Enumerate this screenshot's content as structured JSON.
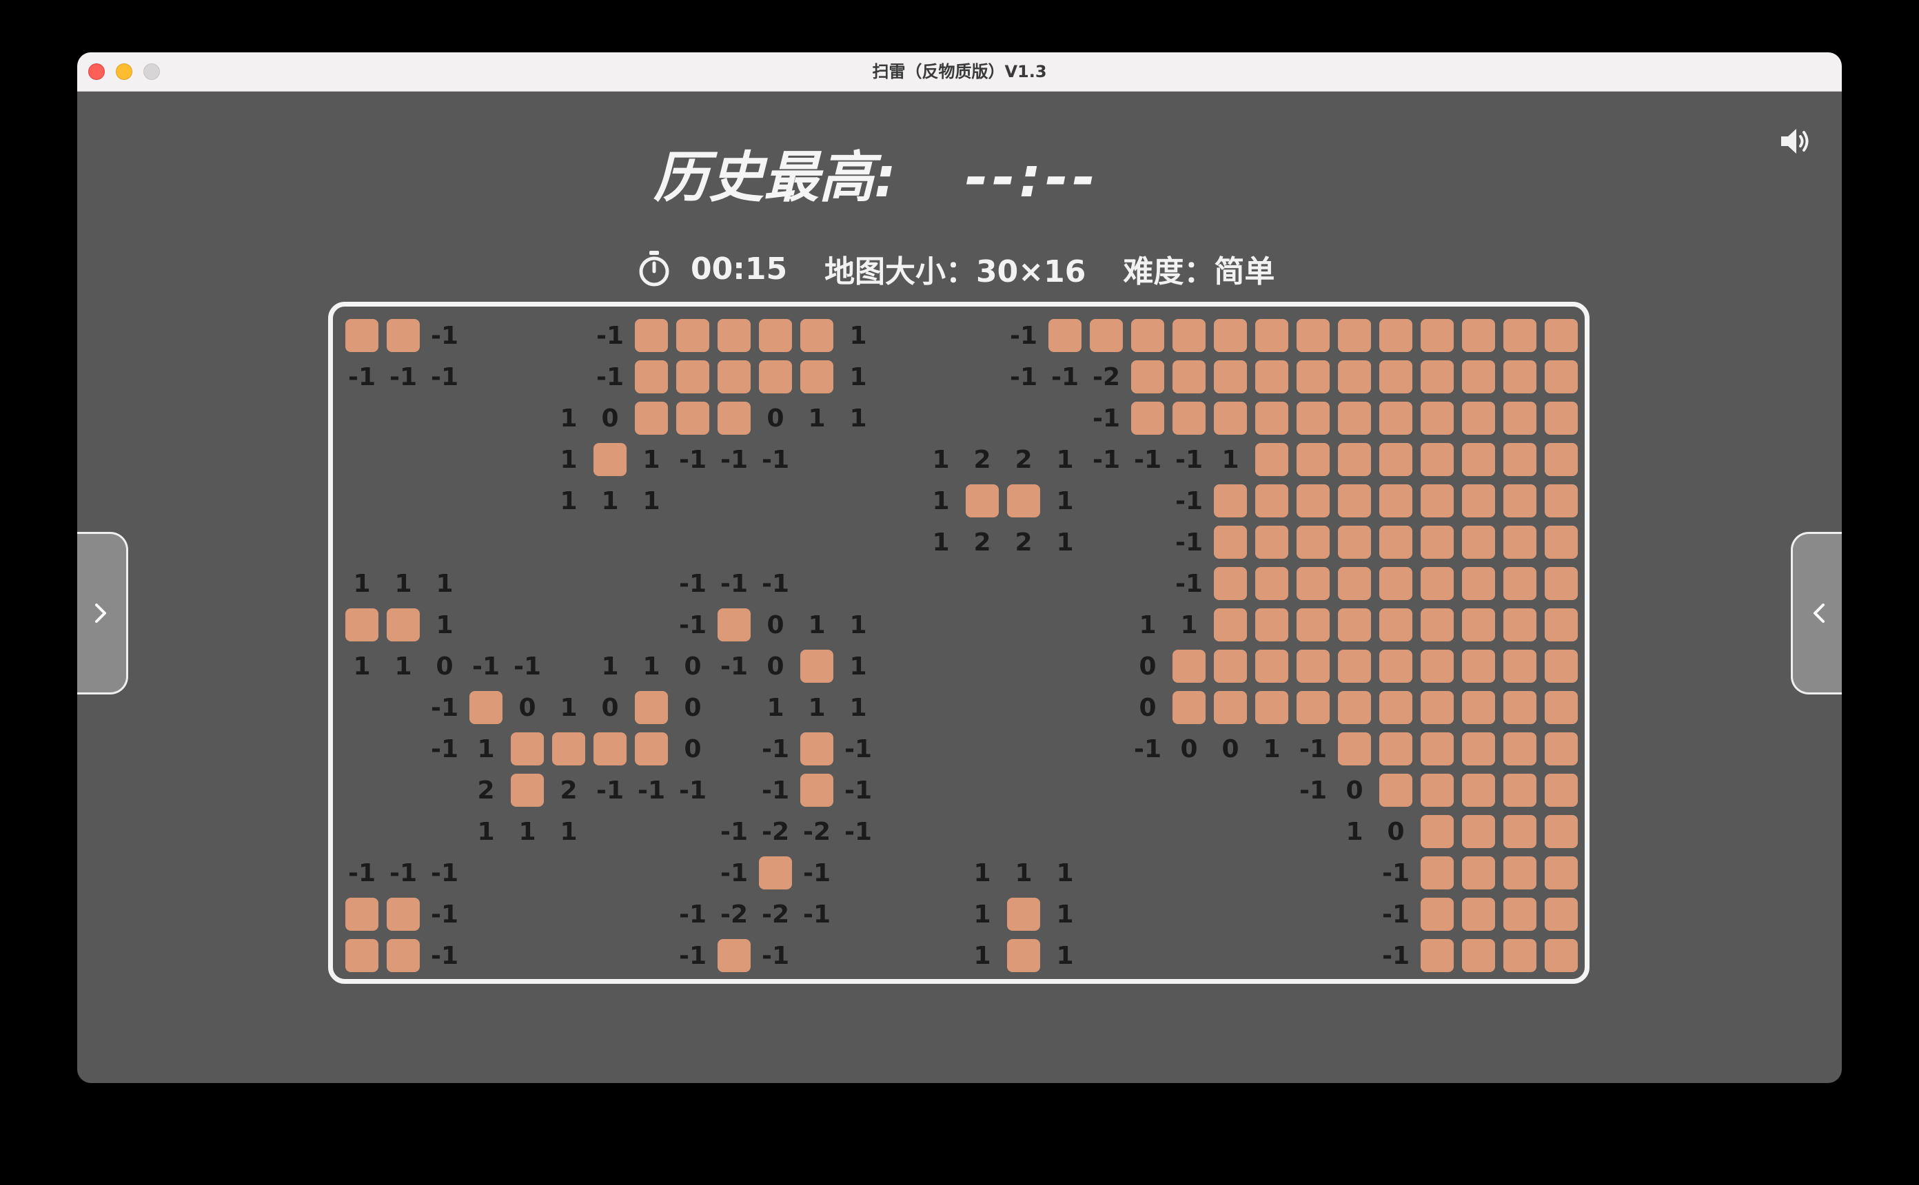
{
  "window": {
    "title": "扫雷（反物质版）V1.3"
  },
  "header": {
    "best_label": "历史最高:",
    "best_value": "--:--"
  },
  "info": {
    "timer": "00:15",
    "map_size": "地图大小：30×16",
    "difficulty": "难度：简单"
  },
  "icons": {
    "sound": "speaker-volume-icon",
    "timer": "stopwatch-icon",
    "left_nav": "chevron-right-icon",
    "right_nav": "chevron-left-icon"
  },
  "colors": {
    "background": "#585858",
    "covered_cell": "#dd9a78",
    "number_text": "#1b1b1b",
    "board_border": "#f4f4f4",
    "nav_button": "#8a8a8a"
  },
  "board": {
    "cols": 30,
    "rows": 16,
    "legend": "# = covered cell, . = empty revealed cell, other values = number shown",
    "grid": [
      [
        "#",
        "#",
        "-1",
        ".",
        ".",
        ".",
        "-1",
        "#",
        "#",
        "#",
        "#",
        "#",
        "1",
        ".",
        ".",
        ".",
        "-1",
        "#",
        "#",
        "#",
        "#",
        "#",
        "#",
        "#",
        "#",
        "#",
        "#",
        "#",
        "#",
        "#"
      ],
      [
        "-1",
        "-1",
        "-1",
        ".",
        ".",
        ".",
        "-1",
        "#",
        "#",
        "#",
        "#",
        "#",
        "1",
        ".",
        ".",
        ".",
        "-1",
        "-1",
        "-2",
        "#",
        "#",
        "#",
        "#",
        "#",
        "#",
        "#",
        "#",
        "#",
        "#",
        "#"
      ],
      [
        ".",
        ".",
        ".",
        ".",
        ".",
        "1",
        "0",
        "#",
        "#",
        "#",
        "0",
        "1",
        "1",
        ".",
        ".",
        ".",
        ".",
        ".",
        "-1",
        "#",
        "#",
        "#",
        "#",
        "#",
        "#",
        "#",
        "#",
        "#",
        "#",
        "#"
      ],
      [
        ".",
        ".",
        ".",
        ".",
        ".",
        "1",
        "#",
        "1",
        "-1",
        "-1",
        "-1",
        ".",
        ".",
        ".",
        "1",
        "2",
        "2",
        "1",
        "-1",
        "-1",
        "-1",
        "1",
        "#",
        "#",
        "#",
        "#",
        "#",
        "#",
        "#",
        "#"
      ],
      [
        ".",
        ".",
        ".",
        ".",
        ".",
        "1",
        "1",
        "1",
        ".",
        ".",
        ".",
        ".",
        ".",
        ".",
        "1",
        "#",
        "#",
        "1",
        ".",
        ".",
        "-1",
        "#",
        "#",
        "#",
        "#",
        "#",
        "#",
        "#",
        "#",
        "#"
      ],
      [
        ".",
        ".",
        ".",
        ".",
        ".",
        ".",
        ".",
        ".",
        ".",
        ".",
        ".",
        ".",
        ".",
        ".",
        "1",
        "2",
        "2",
        "1",
        ".",
        ".",
        "-1",
        "#",
        "#",
        "#",
        "#",
        "#",
        "#",
        "#",
        "#",
        "#"
      ],
      [
        "1",
        "1",
        "1",
        ".",
        ".",
        ".",
        ".",
        ".",
        "-1",
        "-1",
        "-1",
        ".",
        ".",
        ".",
        ".",
        ".",
        ".",
        ".",
        ".",
        ".",
        "-1",
        "#",
        "#",
        "#",
        "#",
        "#",
        "#",
        "#",
        "#",
        "#"
      ],
      [
        "#",
        "#",
        "1",
        ".",
        ".",
        ".",
        ".",
        ".",
        "-1",
        "#",
        "0",
        "1",
        "1",
        ".",
        ".",
        ".",
        ".",
        ".",
        ".",
        "1",
        "1",
        "#",
        "#",
        "#",
        "#",
        "#",
        "#",
        "#",
        "#",
        "#"
      ],
      [
        "1",
        "1",
        "0",
        "-1",
        "-1",
        ".",
        "1",
        "1",
        "0",
        "-1",
        "0",
        "#",
        "1",
        ".",
        ".",
        ".",
        ".",
        ".",
        ".",
        "0",
        "#",
        "#",
        "#",
        "#",
        "#",
        "#",
        "#",
        "#",
        "#",
        "#"
      ],
      [
        ".",
        ".",
        "-1",
        "#",
        "0",
        "1",
        "0",
        "#",
        "0",
        ".",
        "1",
        "1",
        "1",
        ".",
        ".",
        ".",
        ".",
        ".",
        ".",
        "0",
        "#",
        "#",
        "#",
        "#",
        "#",
        "#",
        "#",
        "#",
        "#",
        "#"
      ],
      [
        ".",
        ".",
        "-1",
        "1",
        "#",
        "#",
        "#",
        "#",
        "0",
        ".",
        "-1",
        "#",
        "-1",
        ".",
        ".",
        ".",
        ".",
        ".",
        ".",
        "-1",
        "0",
        "0",
        "1",
        "-1",
        "#",
        "#",
        "#",
        "#",
        "#",
        "#"
      ],
      [
        ".",
        ".",
        ".",
        "2",
        "#",
        "2",
        "-1",
        "-1",
        "-1",
        ".",
        "-1",
        "#",
        "-1",
        ".",
        ".",
        ".",
        ".",
        ".",
        ".",
        ".",
        ".",
        ".",
        ".",
        "-1",
        "0",
        "#",
        "#",
        "#",
        "#",
        "#"
      ],
      [
        ".",
        ".",
        ".",
        "1",
        "1",
        "1",
        ".",
        ".",
        ".",
        "-1",
        "-2",
        "-2",
        "-1",
        ".",
        ".",
        ".",
        ".",
        ".",
        ".",
        ".",
        ".",
        ".",
        ".",
        ".",
        "1",
        "0",
        "#",
        "#",
        "#",
        "#"
      ],
      [
        "-1",
        "-1",
        "-1",
        ".",
        ".",
        ".",
        ".",
        ".",
        ".",
        "-1",
        "#",
        "-1",
        ".",
        ".",
        ".",
        "1",
        "1",
        "1",
        ".",
        ".",
        ".",
        ".",
        ".",
        ".",
        ".",
        "-1",
        "#",
        "#",
        "#",
        "#"
      ],
      [
        "#",
        "#",
        "-1",
        ".",
        ".",
        ".",
        ".",
        ".",
        "-1",
        "-2",
        "-2",
        "-1",
        ".",
        ".",
        ".",
        "1",
        "#",
        "1",
        ".",
        ".",
        ".",
        ".",
        ".",
        ".",
        ".",
        "-1",
        "#",
        "#",
        "#",
        "#"
      ],
      [
        "#",
        "#",
        "-1",
        ".",
        ".",
        ".",
        ".",
        ".",
        "-1",
        "#",
        "-1",
        ".",
        ".",
        ".",
        ".",
        "1",
        "#",
        "1",
        ".",
        ".",
        ".",
        ".",
        ".",
        ".",
        ".",
        "-1",
        "#",
        "#",
        "#",
        "#"
      ]
    ]
  }
}
